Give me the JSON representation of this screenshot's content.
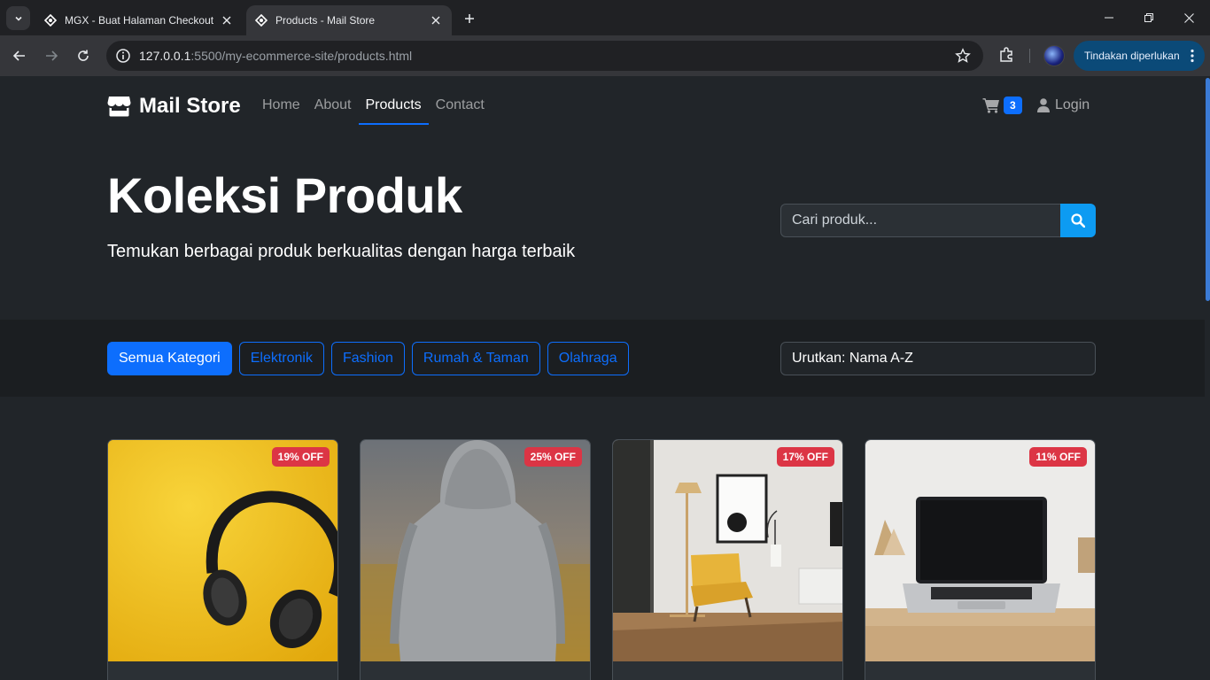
{
  "browser": {
    "tabs": [
      {
        "title": "MGX - Buat Halaman Checkout",
        "active": false
      },
      {
        "title": "Products - Mail Store",
        "active": true
      }
    ],
    "url_host": "127.0.0.1",
    "url_path": ":5500/my-ecommerce-site/products.html",
    "action_pill": "Tindakan diperlukan"
  },
  "navbar": {
    "brand": "Mail Store",
    "links": [
      {
        "label": "Home",
        "active": false
      },
      {
        "label": "About",
        "active": false
      },
      {
        "label": "Products",
        "active": true
      },
      {
        "label": "Contact",
        "active": false
      }
    ],
    "cart_count": "3",
    "login_label": "Login"
  },
  "hero": {
    "title": "Koleksi Produk",
    "subtitle": "Temukan berbagai produk berkualitas dengan harga terbaik",
    "search_placeholder": "Cari produk..."
  },
  "filters": {
    "categories": [
      {
        "label": "Semua Kategori",
        "active": true
      },
      {
        "label": "Elektronik",
        "active": false
      },
      {
        "label": "Fashion",
        "active": false
      },
      {
        "label": "Rumah & Taman",
        "active": false
      },
      {
        "label": "Olahraga",
        "active": false
      }
    ],
    "sort_selected": "Urutkan: Nama A-Z"
  },
  "products": [
    {
      "badge": "19% OFF",
      "image": "headphones-on-yellow"
    },
    {
      "badge": "25% OFF",
      "image": "person-grey-hoodie"
    },
    {
      "badge": "17% OFF",
      "image": "living-room-yellow-chair"
    },
    {
      "badge": "11% OFF",
      "image": "laptop-on-desk"
    }
  ],
  "colors": {
    "primary": "#0d6efd",
    "badge_red": "#dc3545",
    "page_bg": "#212529"
  }
}
